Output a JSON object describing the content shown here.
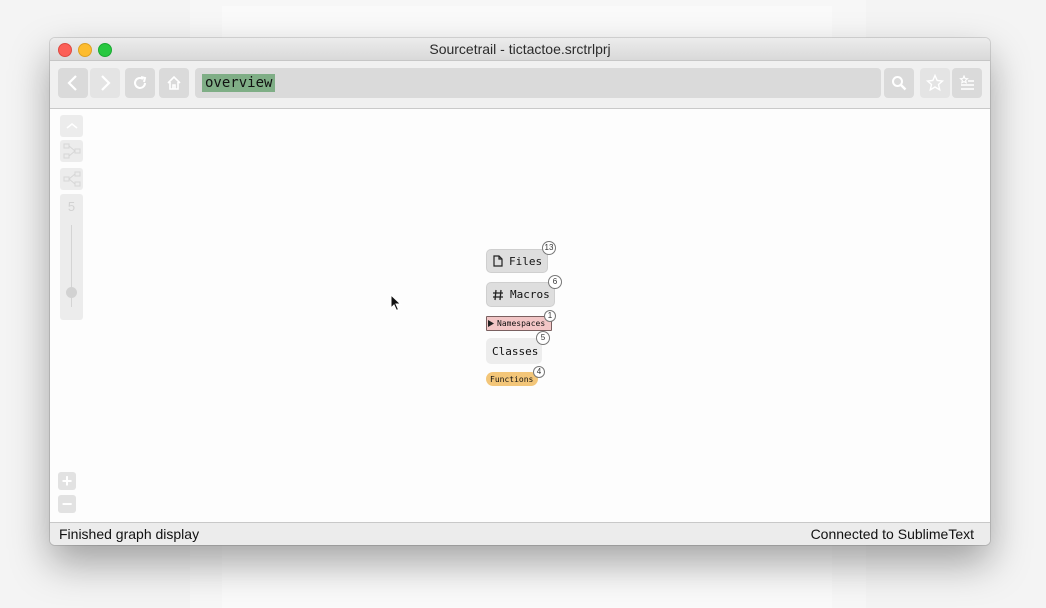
{
  "window": {
    "title": "Sourcetrail - tictactoe.srctrlprj"
  },
  "toolbar": {
    "back_icon": "chevron-left-icon",
    "forward_icon": "chevron-right-icon",
    "refresh_icon": "refresh-icon",
    "home_icon": "home-icon",
    "search_query": "overview",
    "search_icon": "search-icon",
    "bookmark_icon": "star-icon",
    "bookmarks_menu_icon": "bookmark-list-icon"
  },
  "graph_controls": {
    "collapse_icon": "chevron-up-icon",
    "depth_value": "5"
  },
  "overview_nodes": [
    {
      "label": "Files",
      "count": "13",
      "icon": "file-icon"
    },
    {
      "label": "Macros",
      "count": "6",
      "icon": "hash-icon"
    },
    {
      "label": "Namespaces",
      "count": "1",
      "icon": "triangle-right-icon"
    },
    {
      "label": "Classes",
      "count": "5"
    },
    {
      "label": "Functions",
      "count": "4"
    }
  ],
  "zoom": {
    "in_label": "+",
    "out_label": "−"
  },
  "status": {
    "left": "Finished graph display",
    "right": "Connected to SublimeText"
  },
  "colors": {
    "search_chip": "#7fae86",
    "namespace_node": "#f2c6c6",
    "function_node": "#f3c679",
    "file_node": "#dedede"
  }
}
